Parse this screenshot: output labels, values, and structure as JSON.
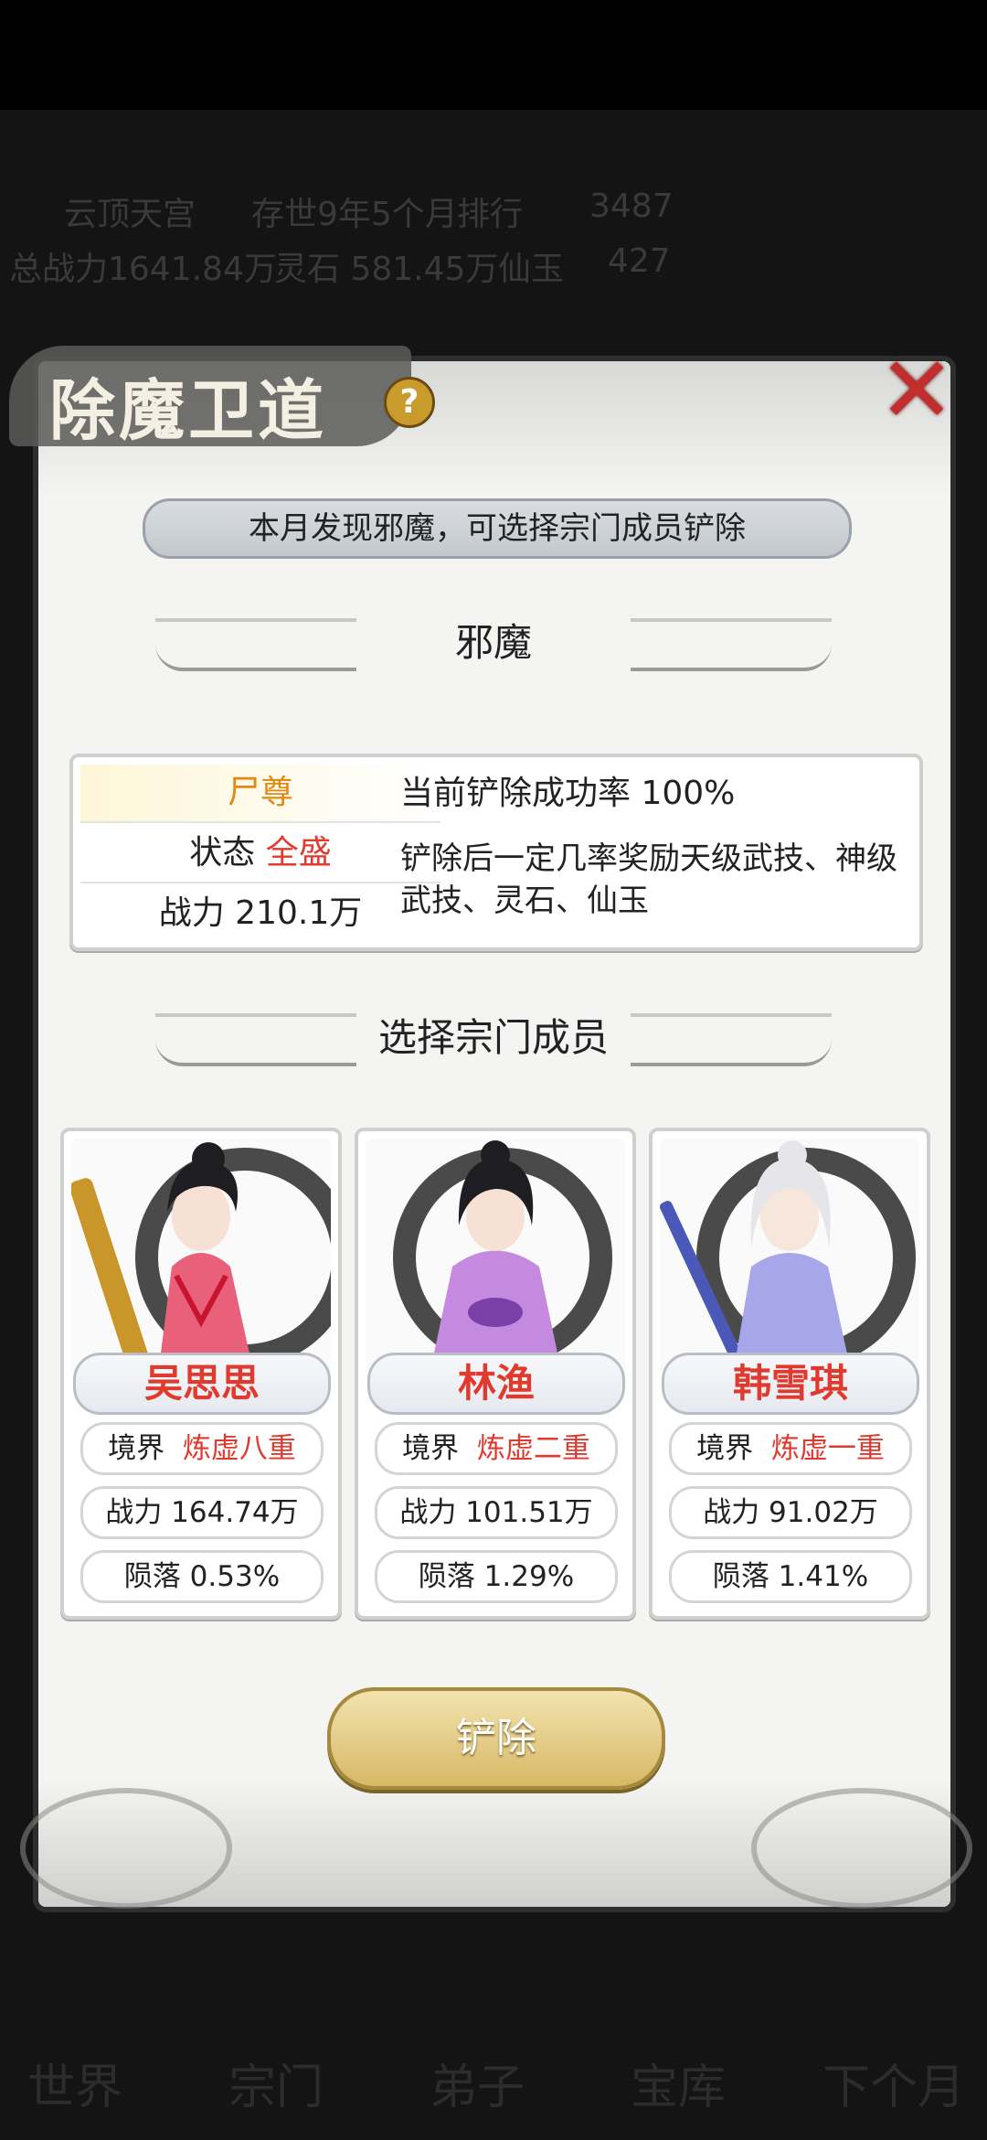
{
  "background": {
    "hud": {
      "sect_name": "云顶天宫",
      "age": "存世9年5个月",
      "ranking_label": "排行",
      "ranking_value": "3487",
      "total_power": "总战力1641.84万",
      "spirit_stone": "灵石 581.45万",
      "immortal_jade_label": "仙玉",
      "immortal_jade_value": "427"
    },
    "nav": [
      "世界",
      "宗门",
      "弟子",
      "宝库",
      "下个月"
    ]
  },
  "dialog": {
    "title": "除魔卫道",
    "help_label": "?",
    "close_label": "✕",
    "notice": "本月发现邪魔，可选择宗门成员铲除",
    "demon_section_title": "邪魔",
    "demon": {
      "name": "尸尊",
      "status_label": "状态",
      "status_value": "全盛",
      "power": "战力 210.1万",
      "success_rate": "当前铲除成功率 100%",
      "reward_text": "铲除后一定几率奖励天级武技、神级武技、灵石、仙玉"
    },
    "member_section_title": "选择宗门成员",
    "members": [
      {
        "name": "吴思思",
        "realm_label": "境界",
        "realm_value": "炼虚八重",
        "power": "战力 164.74万",
        "fall_rate": "陨落 0.53%",
        "robe_color": "#e8607a",
        "accent_color": "#c8142e"
      },
      {
        "name": "林渔",
        "realm_label": "境界",
        "realm_value": "炼虚二重",
        "power": "战力 101.51万",
        "fall_rate": "陨落 1.29%",
        "robe_color": "#c48ae0",
        "accent_color": "#7b3fa8"
      },
      {
        "name": "韩雪琪",
        "realm_label": "境界",
        "realm_value": "炼虚一重",
        "power": "战力 91.02万",
        "fall_rate": "陨落 1.41%",
        "robe_color": "#a6a6e8",
        "accent_color": "#4a58b8"
      }
    ],
    "action_button": "铲除"
  }
}
